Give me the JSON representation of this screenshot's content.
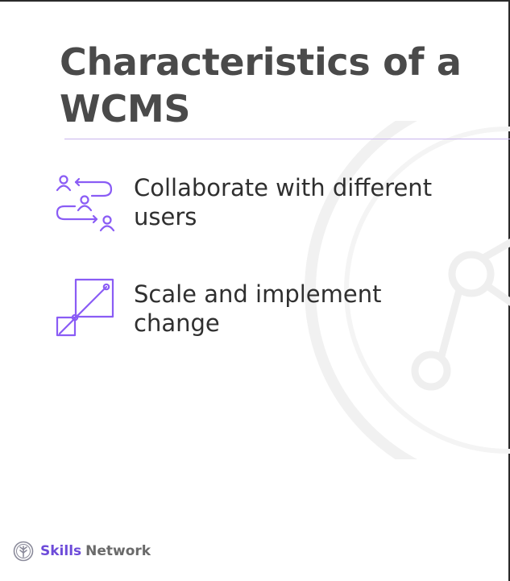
{
  "slide": {
    "title": "Characteristics of a WCMS",
    "items": [
      {
        "icon": "collaboration-users-icon",
        "text": "Collaborate with different users"
      },
      {
        "icon": "scale-resize-icon",
        "text": "Scale and implement change"
      }
    ]
  },
  "footer": {
    "brand_primary": "Skills",
    "brand_secondary": "Network",
    "logo_icon": "skills-network-logo-icon"
  },
  "colors": {
    "accent": "#8a5cf5",
    "title": "#4a4a4a",
    "body_text": "#2f2f2f",
    "divider": "#c9b4ee",
    "watermark": "#f1f1f1"
  }
}
